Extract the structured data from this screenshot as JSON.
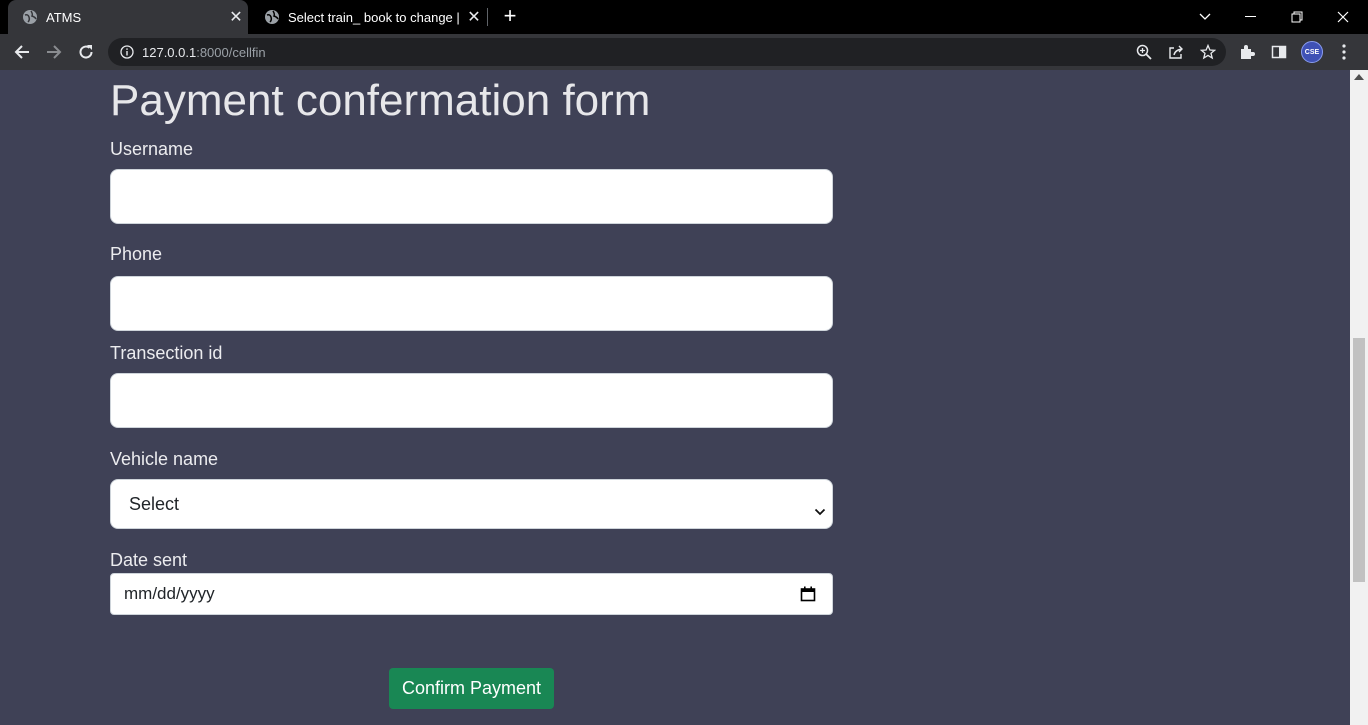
{
  "browser": {
    "tabs": [
      {
        "title": "ATMS",
        "active": true
      },
      {
        "title": "Select train_ book to change | Dj",
        "active": false
      }
    ],
    "url_host": "127.0.0.1",
    "url_path": ":8000/cellfin",
    "avatar_label": "CSE"
  },
  "form": {
    "title": "Payment confermation form",
    "username_label": "Username",
    "username_value": "",
    "phone_label": "Phone",
    "phone_value": "",
    "transaction_label": "Transection id",
    "transaction_value": "",
    "vehicle_label": "Vehicle name",
    "vehicle_selected": "Select",
    "date_label": "Date sent",
    "date_placeholder": "mm/dd/yyyy",
    "submit_label": "Confirm Payment"
  },
  "colors": {
    "page_background": "#3f4156",
    "button_green": "#198754",
    "toolbar": "#35363a",
    "titlebar": "#000000"
  }
}
